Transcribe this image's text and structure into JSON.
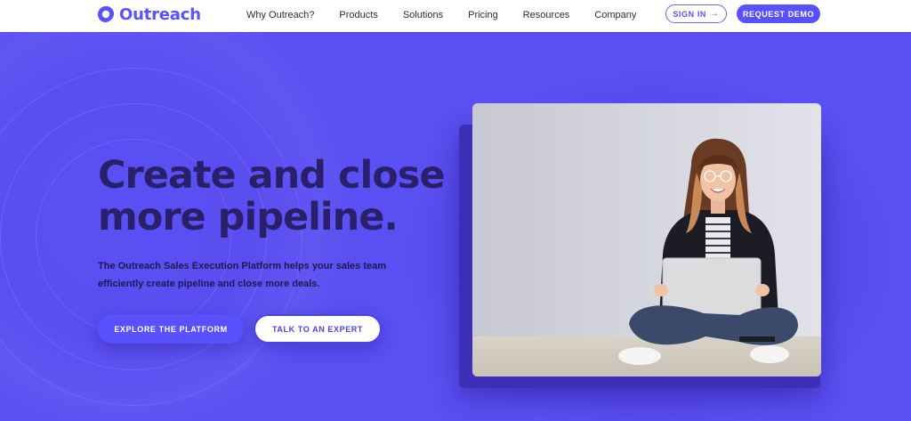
{
  "header": {
    "logo_text": "Outreach",
    "nav": [
      "Why Outreach?",
      "Products",
      "Solutions",
      "Pricing",
      "Resources",
      "Company"
    ],
    "sign_in_label": "SIGN IN",
    "sign_in_arrow": "→",
    "request_demo_label": "REQUEST DEMO"
  },
  "hero": {
    "headline_line1": "Create and close",
    "headline_line2": "more pipeline.",
    "subtext": "The Outreach Sales Execution Platform helps your sales team efficiently create pipeline and close more deals.",
    "explore_label": "EXPLORE THE PLATFORM",
    "expert_label": "TALK TO AN EXPERT"
  },
  "colors": {
    "brand": "#5951ff",
    "hero_bg": "#5a4ff2",
    "headline": "#2a1f6b"
  },
  "icons": {
    "logo": "outreach-logo-icon",
    "arrow": "arrow-right-icon"
  }
}
